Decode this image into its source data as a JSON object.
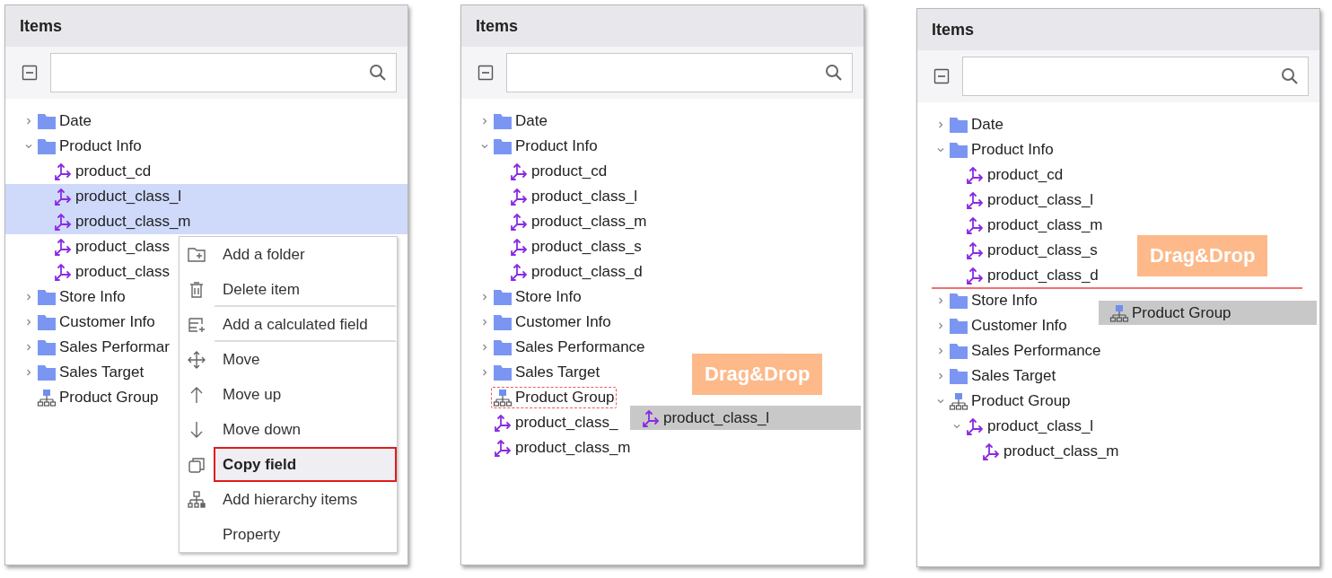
{
  "panels": [
    {
      "title": "Items",
      "tree": [
        {
          "label": "Date",
          "kind": "folder",
          "expanded": false,
          "selected": false
        },
        {
          "label": "Product Info",
          "kind": "folder",
          "expanded": true,
          "selected": false,
          "children": [
            {
              "label": "product_cd",
              "kind": "field",
              "selected": false
            },
            {
              "label": "product_class_l",
              "kind": "field",
              "selected": true
            },
            {
              "label": "product_class_m",
              "kind": "field",
              "selected": true
            },
            {
              "label": "product_class",
              "kind": "field",
              "selected": false
            },
            {
              "label": "product_class",
              "kind": "field",
              "selected": false
            }
          ]
        },
        {
          "label": "Store Info",
          "kind": "folder",
          "expanded": false,
          "selected": false
        },
        {
          "label": "Customer Info",
          "kind": "folder",
          "expanded": false,
          "selected": false
        },
        {
          "label": "Sales Performar",
          "kind": "folder",
          "expanded": false,
          "selected": false
        },
        {
          "label": "Sales Target",
          "kind": "folder",
          "expanded": false,
          "selected": false
        },
        {
          "label": "Product Group",
          "kind": "hierarchy",
          "selected": false
        }
      ],
      "context_menu": [
        {
          "label": "Add a folder",
          "selected": false
        },
        {
          "label": "Delete item",
          "selected": false,
          "separator_after": true
        },
        {
          "label": "Add a calculated field",
          "selected": false,
          "separator_after": true
        },
        {
          "label": "Move",
          "selected": false
        },
        {
          "label": "Move up",
          "selected": false
        },
        {
          "label": "Move down",
          "selected": false
        },
        {
          "label": "Copy field",
          "selected": true
        },
        {
          "label": "Add hierarchy items",
          "selected": false
        },
        {
          "label": "Property",
          "selected": false
        }
      ]
    },
    {
      "title": "Items",
      "tree": [
        {
          "label": "Date",
          "kind": "folder",
          "expanded": false,
          "selected": false
        },
        {
          "label": "Product Info",
          "kind": "folder",
          "expanded": true,
          "selected": false,
          "children": [
            {
              "label": "product_cd",
              "kind": "field",
              "selected": false
            },
            {
              "label": "product_class_l",
              "kind": "field",
              "selected": false
            },
            {
              "label": "product_class_m",
              "kind": "field",
              "selected": false
            },
            {
              "label": "product_class_s",
              "kind": "field",
              "selected": false
            },
            {
              "label": "product_class_d",
              "kind": "field",
              "selected": false
            }
          ]
        },
        {
          "label": "Store Info",
          "kind": "folder",
          "expanded": false,
          "selected": false
        },
        {
          "label": "Customer Info",
          "kind": "folder",
          "expanded": false,
          "selected": false
        },
        {
          "label": "Sales Performance",
          "kind": "folder",
          "expanded": false,
          "selected": false
        },
        {
          "label": "Sales Target",
          "kind": "folder",
          "expanded": false,
          "selected": false
        },
        {
          "label": "Product Group",
          "kind": "hierarchy",
          "selected": false,
          "drop_target": true
        },
        {
          "label": "product_class_",
          "kind": "field",
          "selected": false
        },
        {
          "label": "product_class_m",
          "kind": "field",
          "selected": false
        }
      ],
      "badge": "Drag&Drop",
      "ghost": {
        "label": "product_class_l",
        "kind": "field"
      }
    },
    {
      "title": "Items",
      "tree": [
        {
          "label": "Date",
          "kind": "folder",
          "expanded": false,
          "selected": false
        },
        {
          "label": "Product Info",
          "kind": "folder",
          "expanded": true,
          "selected": false,
          "children": [
            {
              "label": "product_cd",
              "kind": "field",
              "selected": false
            },
            {
              "label": "product_class_l",
              "kind": "field",
              "selected": false
            },
            {
              "label": "product_class_m",
              "kind": "field",
              "selected": false
            },
            {
              "label": "product_class_s",
              "kind": "field",
              "selected": false
            },
            {
              "label": "product_class_d",
              "kind": "field",
              "selected": false,
              "drop_line": true
            }
          ]
        },
        {
          "label": "Store Info",
          "kind": "folder",
          "expanded": false,
          "selected": false
        },
        {
          "label": "Customer Info",
          "kind": "folder",
          "expanded": false,
          "selected": false
        },
        {
          "label": "Sales Performance",
          "kind": "folder",
          "expanded": false,
          "selected": false
        },
        {
          "label": "Sales Target",
          "kind": "folder",
          "expanded": false,
          "selected": false
        },
        {
          "label": "Product Group",
          "kind": "hierarchy",
          "expanded": true,
          "selected": false,
          "children": [
            {
              "label": "product_class_l",
              "kind": "field",
              "expanded": true,
              "selected": false,
              "children": [
                {
                  "label": "product_class_m",
                  "kind": "field",
                  "selected": false
                }
              ]
            }
          ]
        }
      ],
      "badge": "Drag&Drop",
      "ghost": {
        "label": "Product Group",
        "kind": "hierarchy"
      }
    }
  ]
}
